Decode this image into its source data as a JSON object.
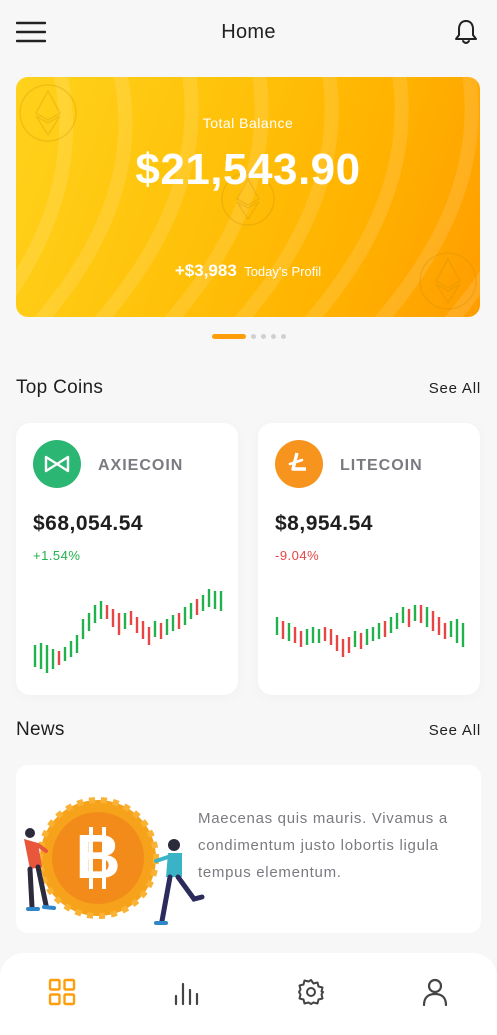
{
  "header": {
    "title": "Home"
  },
  "balance": {
    "label": "Total Balance",
    "amount": "$21,543.90",
    "profit_value": "+$3,983",
    "profit_label": "Today's Profil"
  },
  "carousel": {
    "pages": 5,
    "active": 0
  },
  "top_coins": {
    "title": "Top Coins",
    "see_all": "See All",
    "coins": [
      {
        "name": "AXIECOIN",
        "price": "$68,054.54",
        "change": "+1.54%",
        "trend": "up",
        "logo_color": "#2bb673",
        "icon": "axie-icon"
      },
      {
        "name": "LITECOIN",
        "price": "$8,954.54",
        "change": "-9.04%",
        "trend": "down",
        "logo_color": "#f7941d",
        "icon": "litecoin-icon"
      }
    ]
  },
  "news": {
    "title": "News",
    "see_all": "See All",
    "items": [
      {
        "text": "Maecenas quis mauris. Vivamus a condimentum justo lobortis ligula tempus elementum.",
        "icon": "bitcoin-illustration"
      }
    ]
  },
  "bottom_nav": {
    "items": [
      {
        "icon": "grid-icon",
        "active": true
      },
      {
        "icon": "chart-icon",
        "active": false
      },
      {
        "icon": "settings-icon",
        "active": false
      },
      {
        "icon": "profile-icon",
        "active": false
      }
    ]
  },
  "colors": {
    "accent": "#ff9e0b",
    "positive": "#22b14c",
    "negative": "#e84545",
    "muted_text": "#7a7a80"
  }
}
